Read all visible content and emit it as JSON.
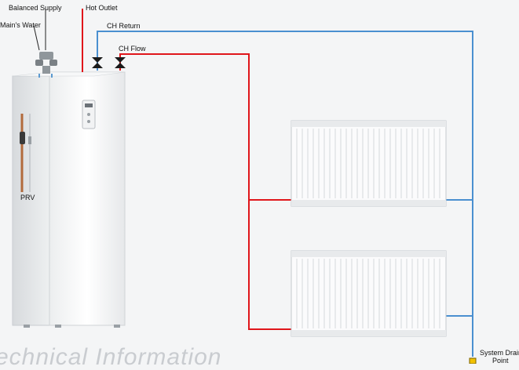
{
  "labels": {
    "balanced_supply": "Balanced Supply",
    "mains_water": "Main's Water",
    "hot_outlet": "Hot Outlet",
    "ch_return": "CH Return",
    "ch_flow": "CH Flow",
    "prv": "PRV",
    "system_drain_line1": "System Drain",
    "system_drain_line2": "Point"
  },
  "heading": "echnical Information",
  "colors": {
    "flow_pipe": "#e0161b",
    "return_pipe": "#4a8fd0",
    "drain_point": "#f2c200",
    "valve": "#1a1a1a"
  }
}
